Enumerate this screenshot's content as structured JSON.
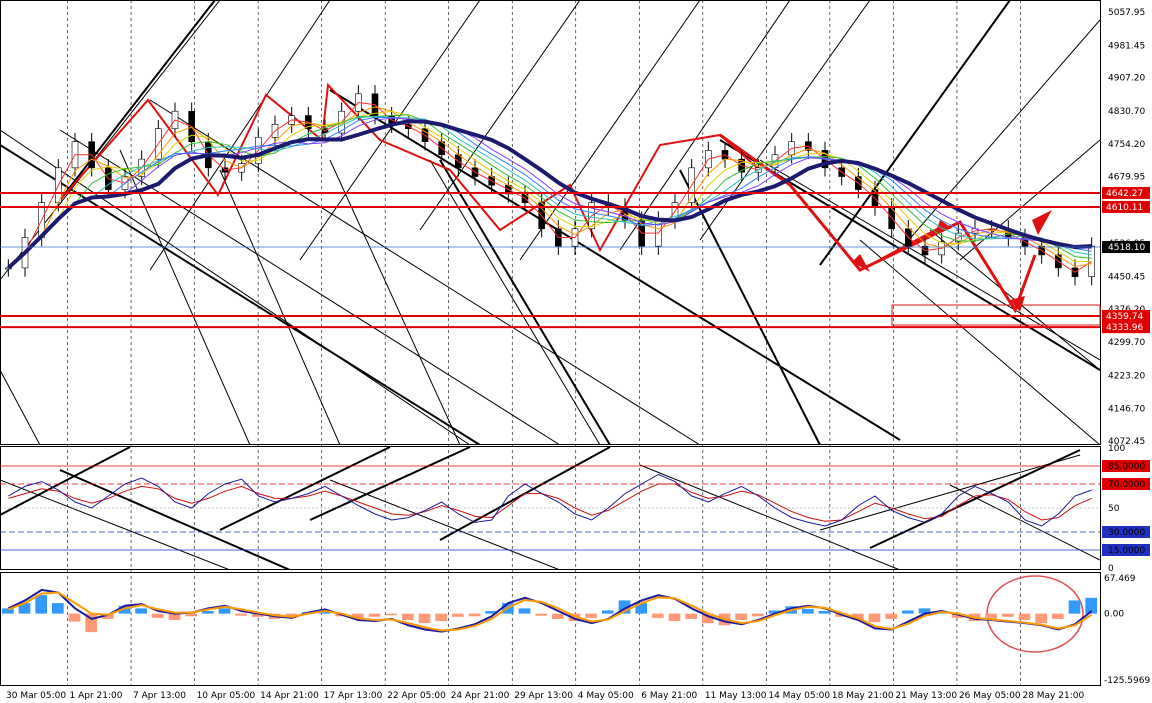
{
  "chart_data": {
    "type": "line",
    "instrument_panel": {
      "price_axis_ticks": [
        "5057.95",
        "4981.45",
        "4907.20",
        "4830.70",
        "4754.20",
        "4679.95",
        "4603.45",
        "4526.95",
        "4450.45",
        "4376.20",
        "4299.70",
        "4223.20",
        "4146.70",
        "4072.45"
      ],
      "ylim": [
        4072.45,
        5057.95
      ],
      "current_price": "4518.10",
      "levels": [
        {
          "value": 4642.27,
          "label": "4642.27",
          "color": "#e00000"
        },
        {
          "value": 4610.11,
          "label": "4610.11",
          "color": "#e00000"
        },
        {
          "value": 4359.74,
          "label": "4359.74",
          "color": "#e00000"
        },
        {
          "value": 4333.96,
          "label": "4333.96",
          "color": "#e00000"
        }
      ],
      "close_series": [
        4470,
        4540,
        4620,
        4700,
        4760,
        4700,
        4650,
        4680,
        4720,
        4790,
        4830,
        4760,
        4700,
        4690,
        4710,
        4770,
        4800,
        4820,
        4790,
        4780,
        4830,
        4870,
        4820,
        4800,
        4790,
        4760,
        4730,
        4700,
        4680,
        4660,
        4640,
        4620,
        4560,
        4520,
        4560,
        4620,
        4610,
        4580,
        4520,
        4580,
        4620,
        4700,
        4740,
        4720,
        4690,
        4700,
        4730,
        4760,
        4740,
        4700,
        4680,
        4650,
        4610,
        4560,
        4520,
        4500,
        4530,
        4550,
        4560,
        4560,
        4540,
        4520,
        4500,
        4470,
        4450,
        4520
      ]
    },
    "rsi_panel": {
      "ticks": [
        "100",
        "85.0000",
        "70.0000",
        "50",
        "30.0000",
        "15.0000",
        "0"
      ],
      "ylim": [
        0,
        100
      ],
      "levels": [
        85,
        70,
        30,
        15
      ],
      "series_main": [
        60,
        68,
        72,
        65,
        55,
        50,
        60,
        70,
        75,
        68,
        55,
        50,
        62,
        70,
        74,
        60,
        55,
        58,
        62,
        68,
        60,
        52,
        45,
        40,
        42,
        48,
        55,
        45,
        38,
        40,
        60,
        70,
        62,
        55,
        45,
        40,
        50,
        62,
        70,
        78,
        72,
        60,
        55,
        62,
        68,
        60,
        50,
        42,
        38,
        35,
        40,
        52,
        60,
        48,
        42,
        38,
        45,
        60,
        68,
        62,
        55,
        40,
        35,
        45,
        60,
        65
      ],
      "series_signal": [
        58,
        62,
        66,
        64,
        58,
        54,
        58,
        64,
        68,
        66,
        58,
        54,
        58,
        64,
        68,
        62,
        58,
        58,
        60,
        64,
        60,
        55,
        50,
        45,
        44,
        47,
        52,
        48,
        43,
        42,
        52,
        62,
        62,
        58,
        50,
        44,
        48,
        56,
        64,
        70,
        70,
        63,
        58,
        60,
        64,
        61,
        54,
        47,
        42,
        39,
        40,
        47,
        54,
        50,
        45,
        41,
        43,
        52,
        60,
        61,
        57,
        47,
        40,
        42,
        52,
        58
      ]
    },
    "macd_panel": {
      "ticks": [
        "67.469",
        "0.00",
        "-125.5969"
      ],
      "ylim": [
        -125.5969,
        67.469
      ],
      "histogram": [
        10,
        20,
        35,
        20,
        -15,
        -35,
        -10,
        15,
        10,
        -8,
        -12,
        -5,
        5,
        10,
        -4,
        -6,
        -10,
        -8,
        3,
        6,
        -5,
        -10,
        -6,
        -3,
        -12,
        -18,
        -14,
        -6,
        -5,
        5,
        20,
        10,
        -4,
        -10,
        -14,
        -8,
        6,
        25,
        20,
        -8,
        -14,
        -10,
        -18,
        -22,
        -12,
        -5,
        6,
        14,
        9,
        5,
        -6,
        -12,
        -16,
        -10,
        6,
        10,
        4,
        -8,
        -14,
        -10,
        -6,
        -12,
        -18,
        -10,
        25,
        30
      ],
      "line_main": [
        10,
        25,
        45,
        40,
        10,
        -10,
        -2,
        15,
        18,
        5,
        0,
        2,
        10,
        15,
        5,
        0,
        -5,
        -8,
        2,
        8,
        -2,
        -12,
        -14,
        -10,
        -22,
        -30,
        -34,
        -28,
        -20,
        -5,
        20,
        30,
        20,
        5,
        -10,
        -18,
        -10,
        10,
        25,
        35,
        28,
        10,
        -5,
        -15,
        -20,
        -12,
        0,
        10,
        15,
        10,
        -2,
        -12,
        -28,
        -30,
        -15,
        0,
        5,
        -2,
        -10,
        -12,
        -15,
        -18,
        -22,
        -30,
        -20,
        5
      ],
      "line_signal": [
        8,
        20,
        38,
        40,
        20,
        0,
        -2,
        10,
        16,
        8,
        2,
        2,
        8,
        13,
        8,
        2,
        -3,
        -6,
        0,
        5,
        0,
        -9,
        -12,
        -11,
        -18,
        -26,
        -32,
        -30,
        -23,
        -10,
        12,
        26,
        22,
        10,
        -5,
        -15,
        -11,
        5,
        20,
        31,
        29,
        15,
        0,
        -11,
        -18,
        -14,
        -3,
        7,
        13,
        11,
        1,
        -9,
        -24,
        -29,
        -19,
        -4,
        3,
        0,
        -8,
        -11,
        -14,
        -17,
        -21,
        -28,
        -22,
        -2
      ]
    },
    "x_ticks": [
      "30 Mar 05:00",
      "1 Apr 21:00",
      "7 Apr 13:00",
      "10 Apr 05:00",
      "14 Apr 21:00",
      "17 Apr 13:00",
      "22 Apr 05:00",
      "24 Apr 21:00",
      "29 Apr 13:00",
      "4 May 05:00",
      "6 May 21:00",
      "11 May 13:00",
      "14 May 05:00",
      "18 May 21:00",
      "21 May 13:00",
      "26 May 05:00",
      "28 May 21:00"
    ],
    "grid": true,
    "colors": {
      "level": "#e00000",
      "ema_slow": "#1b1a6e",
      "rsi_main": "#1a1aa0",
      "rsi_signal": "#d01010",
      "macd_main": "#1a1aa0",
      "macd_signal": "#ff9900",
      "hist_up": "#3399ff",
      "hist_down": "#ff9977"
    }
  }
}
